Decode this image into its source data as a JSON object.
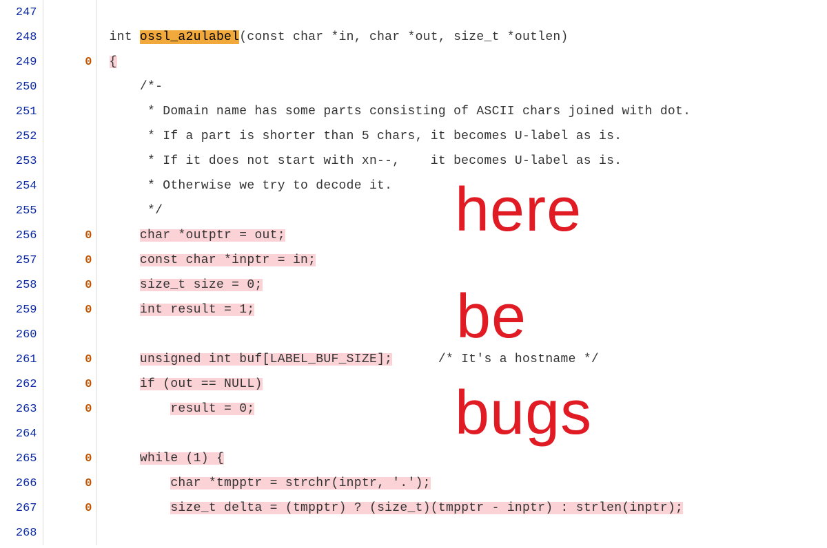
{
  "annotation": {
    "line1": "here",
    "line2": "be",
    "line3": "bugs"
  },
  "fn_highlight": "ossl_a2ulabel",
  "lines": [
    {
      "n": "247",
      "count": "",
      "pre": "",
      "hl": "",
      "post": ""
    },
    {
      "n": "248",
      "count": "",
      "pre": "int ",
      "fn": "ossl_a2ulabel",
      "post": "(const char *in, char *out, size_t *outlen)"
    },
    {
      "n": "249",
      "count": "0",
      "pre": "",
      "hl": "{",
      "post": ""
    },
    {
      "n": "250",
      "count": "",
      "pre": "    /*-",
      "hl": "",
      "post": ""
    },
    {
      "n": "251",
      "count": "",
      "pre": "     * Domain name has some parts consisting of ASCII chars joined with dot.",
      "hl": "",
      "post": ""
    },
    {
      "n": "252",
      "count": "",
      "pre": "     * If a part is shorter than 5 chars, it becomes U-label as is.",
      "hl": "",
      "post": ""
    },
    {
      "n": "253",
      "count": "",
      "pre": "     * If it does not start with xn--,    it becomes U-label as is.",
      "hl": "",
      "post": ""
    },
    {
      "n": "254",
      "count": "",
      "pre": "     * Otherwise we try to decode it.",
      "hl": "",
      "post": ""
    },
    {
      "n": "255",
      "count": "",
      "pre": "     */",
      "hl": "",
      "post": ""
    },
    {
      "n": "256",
      "count": "0",
      "pre": "    ",
      "hl": "char *outptr = out;",
      "post": ""
    },
    {
      "n": "257",
      "count": "0",
      "pre": "    ",
      "hl": "const char *inptr = in;",
      "post": ""
    },
    {
      "n": "258",
      "count": "0",
      "pre": "    ",
      "hl": "size_t size = 0;",
      "post": ""
    },
    {
      "n": "259",
      "count": "0",
      "pre": "    ",
      "hl": "int result = 1;",
      "post": ""
    },
    {
      "n": "260",
      "count": "",
      "pre": "",
      "hl": "",
      "post": ""
    },
    {
      "n": "261",
      "count": "0",
      "pre": "    ",
      "hl": "unsigned int buf[LABEL_BUF_SIZE];",
      "post": "      /* It's a hostname */"
    },
    {
      "n": "262",
      "count": "0",
      "pre": "    ",
      "hl": "if (out == NULL)",
      "post": ""
    },
    {
      "n": "263",
      "count": "0",
      "pre": "        ",
      "hl": "result = 0;",
      "post": ""
    },
    {
      "n": "264",
      "count": "",
      "pre": "",
      "hl": "",
      "post": ""
    },
    {
      "n": "265",
      "count": "0",
      "pre": "    ",
      "hl": "while (1) {",
      "post": ""
    },
    {
      "n": "266",
      "count": "0",
      "pre": "        ",
      "hl": "char *tmpptr = strchr(inptr, '.');",
      "post": ""
    },
    {
      "n": "267",
      "count": "0",
      "pre": "        ",
      "hl": "size_t delta = (tmpptr) ? (size_t)(tmpptr - inptr) : strlen(inptr);",
      "post": ""
    },
    {
      "n": "268",
      "count": "",
      "pre": "",
      "hl": "",
      "post": ""
    }
  ]
}
